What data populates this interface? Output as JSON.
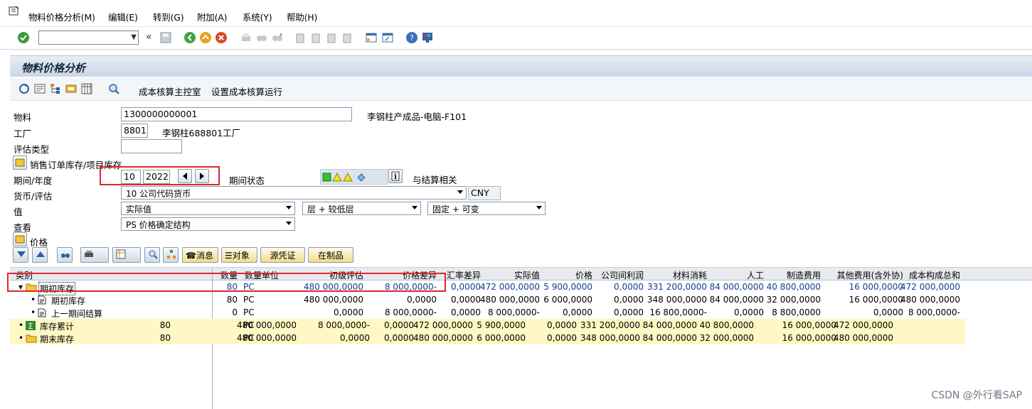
{
  "menu": {
    "items": [
      "物料价格分析(M)",
      "编辑(E)",
      "转到(G)",
      "附加(A)",
      "系统(Y)",
      "帮助(H)"
    ]
  },
  "toolbar": {
    "back_chevron": "«",
    "icons": [
      "check-icon",
      "save-icon",
      "back-icon",
      "exit-icon",
      "cancel-icon",
      "print-icon",
      "find-icon",
      "find-next-icon",
      "first-page-icon",
      "prev-page-icon",
      "next-page-icon",
      "last-page-icon",
      "new-session-icon",
      "shortcut-icon",
      "help-icon",
      "customize-layout-icon"
    ]
  },
  "title": "物料价格分析",
  "apptoolbar": {
    "btn1": "成本核算主控室",
    "btn2": "设置成本核算运行"
  },
  "form": {
    "material_label": "物料",
    "material_value": "1300000000001",
    "material_desc": "李钢柱产成品-电脑-F101",
    "plant_label": "工厂",
    "plant_value": "8801",
    "plant_desc": "李钢柱688801工厂",
    "valtype_label": "评估类型",
    "valtype_value": "",
    "sales_order_label": "销售订单库存/项目库存",
    "period_label": "期间/年度",
    "period_value": "10",
    "year_value": "2022",
    "period_status_label": "期间状态",
    "period_status_text": "与结算相关",
    "currency_label": "货币/评估",
    "currency_value": "10 公司代码货币",
    "currency_code": "CNY",
    "value_label": "值",
    "value_sel1": "实际值",
    "value_sel2": "层 + 较低层",
    "value_sel3": "固定 + 可变",
    "view_label": "查看",
    "view_value": "PS 价格确定结构",
    "price_label": "价格"
  },
  "alv": {
    "msg_label": "消息",
    "obj_label": "对象",
    "doc_label": "源凭证",
    "wip_label": "在制品"
  },
  "grid": {
    "headers": [
      "类别",
      "数量",
      "数量单位",
      "初级评估",
      "价格差异",
      "汇率差异",
      "实际值",
      "价格",
      "公司间利润",
      "材料消耗",
      "人工",
      "制造费用",
      "其他费用(含外协)",
      "成本构成总和"
    ],
    "rows": [
      {
        "label": "期初库存",
        "qty": "80",
        "unit": "PC",
        "prim": "480 000,0000",
        "pvar": "8 000,0000-",
        "fx": "0,0000",
        "act": "472 000,0000",
        "price": "5 900,0000",
        "ic": "0,0000",
        "mat": "331 200,0000",
        "lab": "84 000,0000",
        "ovh": "40 800,0000",
        "oth": "16 000,0000",
        "tot": "472 000,0000"
      },
      {
        "label": "期初库存",
        "qty": "80",
        "unit": "PC",
        "prim": "480 000,0000",
        "pvar": "0,0000",
        "fx": "0,0000",
        "act": "480 000,0000",
        "price": "6 000,0000",
        "ic": "0,0000",
        "mat": "348 000,0000",
        "lab": "84 000,0000",
        "ovh": "32 000,0000",
        "oth": "16 000,0000",
        "tot": "480 000,0000"
      },
      {
        "label": "上一期间结算",
        "qty": "0",
        "unit": "PC",
        "prim": "0,0000",
        "pvar": "8 000,0000-",
        "fx": "0,0000",
        "act": "8 000,0000-",
        "price": "0,0000",
        "ic": "0,0000",
        "mat": "16 800,0000-",
        "lab": "0,0000",
        "ovh": "8 800,0000",
        "oth": "0,0000",
        "tot": "8 000,0000-"
      },
      {
        "label": "库存累计",
        "qty": "80",
        "unit": "PC",
        "prim": "480 000,0000",
        "pvar": "8 000,0000-",
        "fx": "0,0000",
        "act": "472 000,0000",
        "price": "5 900,0000",
        "ic": "0,0000",
        "mat": "331 200,0000",
        "lab": "84 000,0000",
        "ovh": "40 800,0000",
        "oth": "16 000,0000",
        "tot": "472 000,0000"
      },
      {
        "label": "期末库存",
        "qty": "80",
        "unit": "PC",
        "prim": "480 000,0000",
        "pvar": "0,0000",
        "fx": "0,0000",
        "act": "480 000,0000",
        "price": "6 000,0000",
        "ic": "0,0000",
        "mat": "348 000,0000",
        "lab": "84 000,0000",
        "ovh": "32 000,0000",
        "oth": "16 000,0000",
        "tot": "480 000,0000"
      }
    ]
  },
  "watermark": "CSDN @外行看SAP"
}
